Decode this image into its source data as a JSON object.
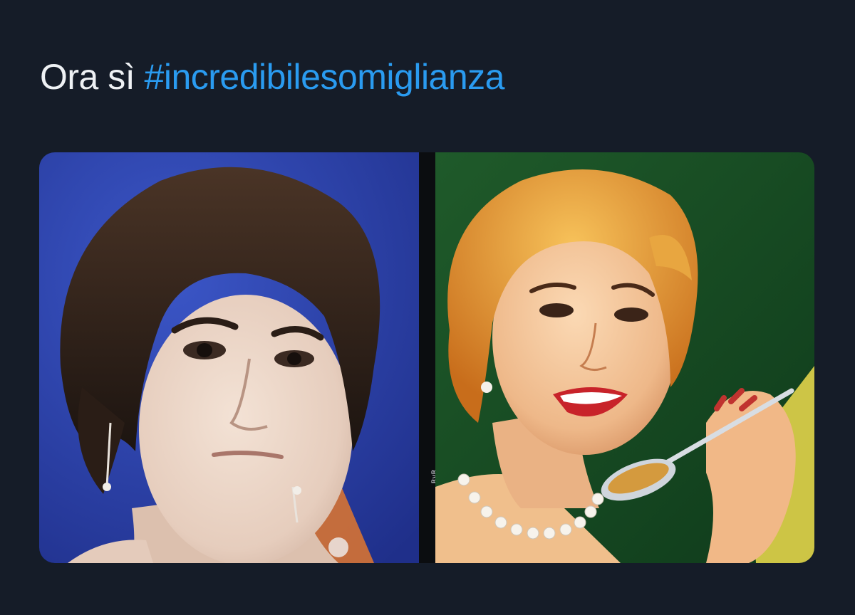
{
  "tweet": {
    "text_prefix": "Ora sì ",
    "hashtag": "#incredibilesomiglianza"
  },
  "media": {
    "watermark": "RvR",
    "left_photo": "portrait-photo-man-dark-hair-eyeliner",
    "right_photo": "vintage-illustration-woman-with-spoon"
  },
  "colors": {
    "background": "#151c28",
    "text": "#eef1f4",
    "hashtag": "#2a9bf0"
  }
}
